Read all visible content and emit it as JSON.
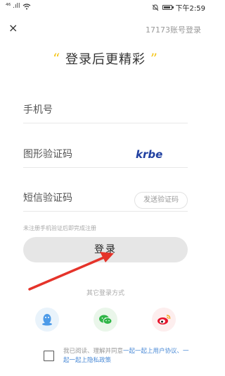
{
  "status_bar": {
    "signal": "⁴⁶ .ıll",
    "wifi": "wifi-icon",
    "time": "下午2:59"
  },
  "header": {
    "close_label": "×",
    "account_login": "17173账号登录"
  },
  "headline": {
    "open_quote": "“",
    "text": "登录后更精彩",
    "close_quote": "”"
  },
  "form": {
    "phone_label": "手机号",
    "captcha_label": "图形验证码",
    "captcha_text": "krbe",
    "sms_label": "短信验证码",
    "send_code": "发送验证码",
    "hint": "未注册手机验证后即完成注册",
    "login": "登录"
  },
  "other": {
    "title": "其它登录方式",
    "methods": [
      "qq-icon",
      "wechat-icon",
      "weibo-icon"
    ]
  },
  "agreement": {
    "prefix": "我已阅读、理解并同意",
    "link1": "一起一起上用户协议",
    "sep": "、",
    "link2": "一起一起上隐私政策"
  },
  "colors": {
    "accent_quote": "#f5c518",
    "link": "#4a8ad6",
    "arrow": "#e5332a",
    "captcha": "#1f3fa0"
  }
}
